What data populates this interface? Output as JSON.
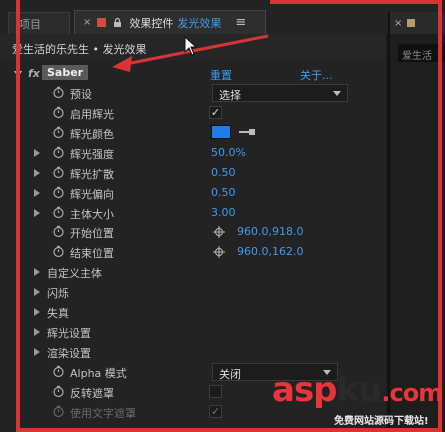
{
  "tabs": {
    "left_label": "项目",
    "active_title": "效果控件",
    "active_layer": "发光效果",
    "menu_glyph": "≡",
    "close_glyph": "×"
  },
  "right_panel": {
    "tab_label": "",
    "field_text": "爱生活"
  },
  "breadcrumb": "爱生活的乐先生 • 发光效果",
  "effect": {
    "name": "Saber",
    "fx": "fx",
    "reset": "重置",
    "about": "关于..."
  },
  "props": {
    "preset": {
      "label": "预设",
      "value": "选择"
    },
    "enable_glow": {
      "label": "启用辉光",
      "check": "✓"
    },
    "glow_color": {
      "label": "辉光颜色",
      "color": "#1f7fe8"
    },
    "glow_intensity": {
      "label": "辉光强度",
      "value": "50.0%"
    },
    "glow_spread": {
      "label": "辉光扩散",
      "value": "0.50"
    },
    "glow_bias": {
      "label": "辉光偏向",
      "value": "0.50"
    },
    "core_size": {
      "label": "主体大小",
      "value": "3.00"
    },
    "start_pos": {
      "label": "开始位置",
      "value": "960.0,918.0"
    },
    "end_pos": {
      "label": "结束位置",
      "value": "960.0,162.0"
    }
  },
  "groups": [
    "自定义主体",
    "闪烁",
    "失真",
    "辉光设置",
    "渲染设置"
  ],
  "render": {
    "alpha_mode": {
      "label": "Alpha 模式",
      "value": "关闭"
    },
    "invert_mask": {
      "label": "反转遮罩"
    },
    "use_text_mask": {
      "label": "使用文字遮罩",
      "check": "✓"
    }
  },
  "watermark": {
    "brand_red": "asp",
    "brand_dark": "ku",
    "brand_red2": ".com",
    "tagline": "免费网站源码下载站!"
  },
  "colors": {
    "accent": "#3d9cf0",
    "annotation": "#d83434"
  }
}
